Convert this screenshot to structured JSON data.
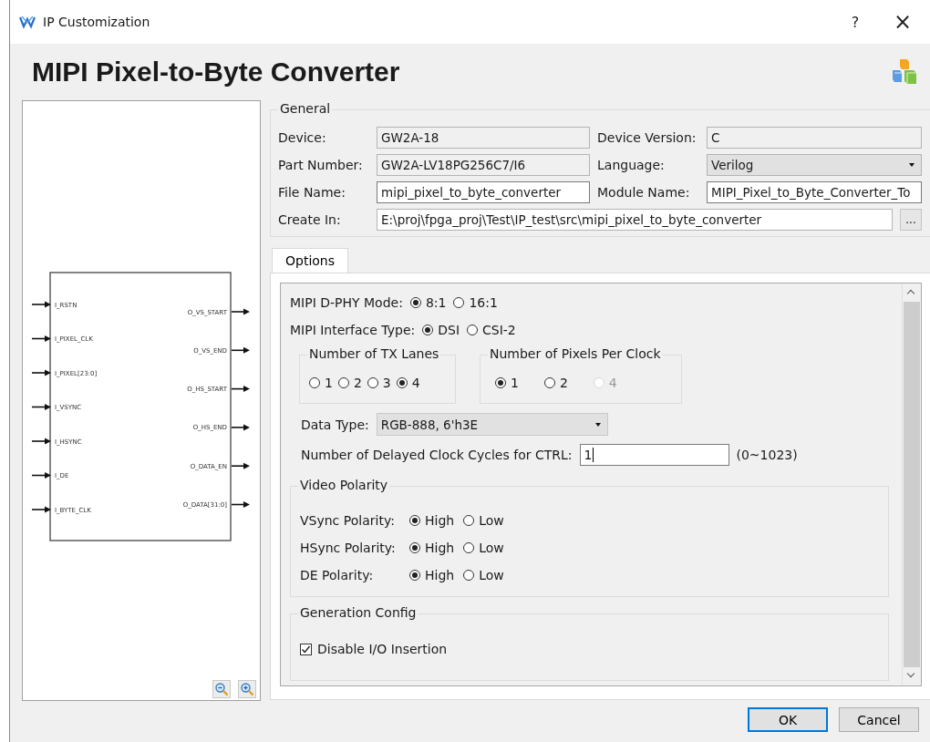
{
  "window": {
    "title": "IP Customization",
    "help": "?",
    "close": "×"
  },
  "heading": "MIPI Pixel-to-Byte Converter",
  "diagram": {
    "inputs": [
      "I_RSTN",
      "I_PIXEL_CLK",
      "I_PIXEL[23:0]",
      "I_VSYNC",
      "I_HSYNC",
      "I_DE",
      "I_BYTE_CLK"
    ],
    "outputs": [
      "O_VS_START",
      "O_VS_END",
      "O_HS_START",
      "O_HS_END",
      "O_DATA_EN",
      "O_DATA[31:0]"
    ]
  },
  "general": {
    "title": "General",
    "fields": [
      {
        "label": "Device:",
        "value": "GW2A-18",
        "kind": "readonly"
      },
      {
        "label": "Device Version:",
        "value": "C",
        "kind": "readonly"
      },
      {
        "label": "Part Number:",
        "value": "GW2A-LV18PG256C7/I6",
        "kind": "readonly"
      },
      {
        "label": "Language:",
        "value": "Verilog",
        "kind": "select"
      },
      {
        "label": "File Name:",
        "value": "mipi_pixel_to_byte_converter",
        "kind": "text"
      },
      {
        "label": "Module Name:",
        "value": "MIPI_Pixel_to_Byte_Converter_To",
        "kind": "text"
      },
      {
        "label": "Create In:",
        "value": "E:\\proj\\fpga_proj\\Test\\IP_test\\src\\mipi_pixel_to_byte_converter",
        "kind": "path",
        "browse": "..."
      }
    ]
  },
  "tabs": [
    {
      "label": "Options",
      "selected": true
    }
  ],
  "options": [
    {
      "kind": "radio-row",
      "label": "MIPI D-PHY Mode:",
      "choices": [
        {
          "label": "8:1",
          "selected": true,
          "disabled": false
        },
        {
          "label": "16:1",
          "selected": false,
          "disabled": false
        }
      ]
    },
    {
      "kind": "radio-row",
      "label": "MIPI Interface Type:",
      "choices": [
        {
          "label": "DSI",
          "selected": true,
          "disabled": false
        },
        {
          "label": "CSI-2",
          "selected": false,
          "disabled": false
        }
      ]
    },
    {
      "kind": "radio-groups",
      "groups": [
        {
          "title": "Number of TX Lanes",
          "choices": [
            {
              "label": "1",
              "selected": false,
              "disabled": false
            },
            {
              "label": "2",
              "selected": false,
              "disabled": false
            },
            {
              "label": "3",
              "selected": false,
              "disabled": false
            },
            {
              "label": "4",
              "selected": true,
              "disabled": false
            }
          ]
        },
        {
          "title": "Number of Pixels Per Clock",
          "choices": [
            {
              "label": "1",
              "selected": true,
              "disabled": false
            },
            {
              "label": "2",
              "selected": false,
              "disabled": false
            },
            {
              "label": "4",
              "selected": false,
              "disabled": true
            }
          ]
        }
      ]
    },
    {
      "kind": "select",
      "label": "Data Type:",
      "value": "RGB-888, 6'h3E"
    },
    {
      "kind": "number",
      "label": "Number of Delayed Clock Cycles for CTRL:",
      "value": "1",
      "hint": "(0~1023)"
    },
    {
      "kind": "group",
      "title": "Video Polarity",
      "rows": [
        {
          "label": "VSync Polarity:",
          "choices": [
            {
              "label": "High",
              "selected": true,
              "disabled": false
            },
            {
              "label": "Low",
              "selected": false,
              "disabled": false
            }
          ]
        },
        {
          "label": "HSync Polarity:",
          "choices": [
            {
              "label": "High",
              "selected": true,
              "disabled": false
            },
            {
              "label": "Low",
              "selected": false,
              "disabled": false
            }
          ]
        },
        {
          "label": "DE Polarity:",
          "choices": [
            {
              "label": "High",
              "selected": true,
              "disabled": false
            },
            {
              "label": "Low",
              "selected": false,
              "disabled": false
            }
          ]
        }
      ]
    },
    {
      "kind": "checkgroup",
      "title": "Generation Config",
      "checks": [
        {
          "label": "Disable I/O Insertion",
          "checked": true
        }
      ]
    }
  ],
  "buttons": [
    {
      "label": "OK",
      "default": true
    },
    {
      "label": "Cancel",
      "default": false
    }
  ]
}
